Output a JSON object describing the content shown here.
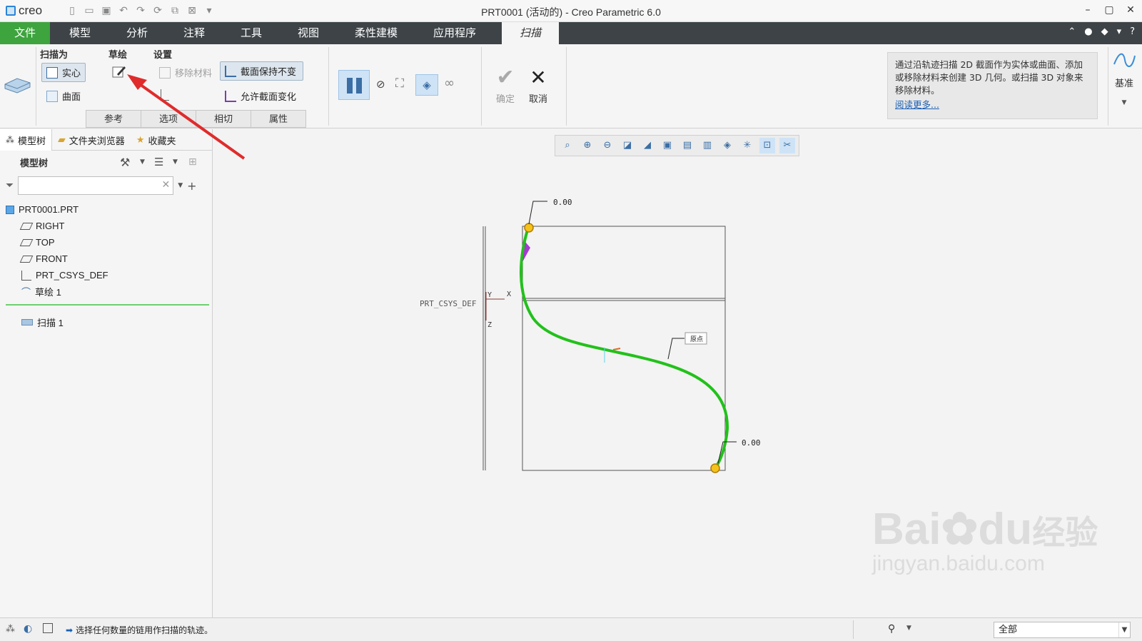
{
  "app": {
    "logo_text": "creo",
    "window_title": "PRT0001 (活动的) - Creo Parametric 6.0"
  },
  "menu": {
    "tabs": [
      "文件",
      "模型",
      "分析",
      "注释",
      "工具",
      "视图",
      "柔性建模",
      "应用程序",
      "扫描"
    ],
    "active_tab": "扫描"
  },
  "ribbon": {
    "sweep_as_label": "扫描为",
    "solid_label": "实心",
    "surface_label": "曲面",
    "sketch_label": "草绘",
    "settings_label": "设置",
    "remove_material_label": "移除材料",
    "constant_section_label": "截面保持不变",
    "variable_section_label": "允许截面变化",
    "subtabs": [
      "参考",
      "选项",
      "相切",
      "属性"
    ],
    "ok_label": "确定",
    "cancel_label": "取消",
    "datum_label": "基准",
    "info_text": "通过沿轨迹扫描 2D 截面作为实体或曲面、添加或移除材料来创建 3D 几何。或扫描 3D 对象来移除材料。",
    "read_more": "阅读更多..."
  },
  "left_panel": {
    "tabs": [
      "模型树",
      "文件夹浏览器",
      "收藏夹"
    ],
    "tree_title": "模型树",
    "filter_placeholder": "",
    "items": [
      {
        "label": "PRT0001.PRT",
        "icon": "part-icon"
      },
      {
        "label": "RIGHT",
        "icon": "datum-plane-icon"
      },
      {
        "label": "TOP",
        "icon": "datum-plane-icon"
      },
      {
        "label": "FRONT",
        "icon": "datum-plane-icon"
      },
      {
        "label": "PRT_CSYS_DEF",
        "icon": "csys-icon"
      },
      {
        "label": "草绘 1",
        "icon": "sketch-icon"
      }
    ],
    "insert_item": {
      "label": "扫描 1",
      "icon": "sweep-icon"
    }
  },
  "canvas": {
    "csys_label": "PRT_CSYS_DEF",
    "axis_y": "Y",
    "axis_x": "X",
    "axis_z": "Z",
    "dim_top": "0.00",
    "dim_bottom": "0.00",
    "origin_label": "原点",
    "curve_color": "#22c11a",
    "point_color": "#f5c21a"
  },
  "status": {
    "message": "选择任何数量的链用作扫描的轨迹。",
    "filter_value": "全部"
  },
  "watermark": {
    "text1": "Bai",
    "text2": "du",
    "text3": "经验",
    "url": "jingyan.baidu.com"
  }
}
